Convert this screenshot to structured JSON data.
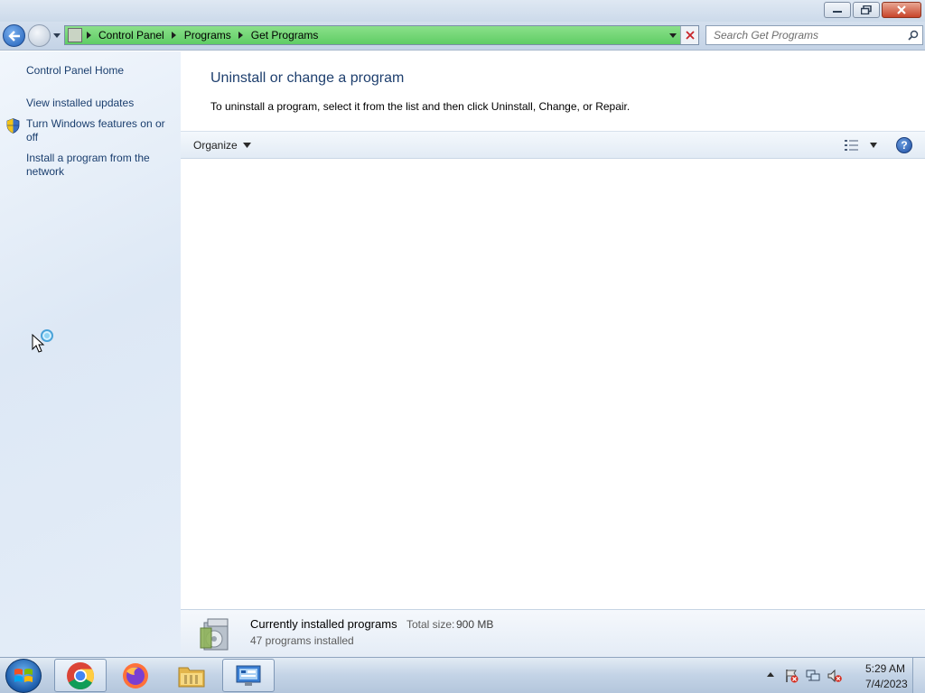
{
  "window": {
    "caption_buttons": [
      {
        "name": "minimize",
        "icon": "minimize-icon"
      },
      {
        "name": "maximize",
        "icon": "restore-icon"
      },
      {
        "name": "close",
        "icon": "close-icon"
      }
    ]
  },
  "navbar": {
    "breadcrumbs": [
      "Control Panel",
      "Programs",
      "Get Programs"
    ],
    "search_placeholder": "Search Get Programs",
    "address_color": "#6bd26f"
  },
  "sidebar": {
    "items": [
      {
        "label": "Control Panel Home"
      },
      {
        "label": "View installed updates"
      },
      {
        "label": "Turn Windows features on or off",
        "icon": "uac-shield-icon"
      },
      {
        "label": "Install a program from the network"
      }
    ]
  },
  "main": {
    "title": "Uninstall or change a program",
    "description": "To uninstall a program, select it from the list and then click Uninstall, Change, or Repair.",
    "toolbar": {
      "organize_label": "Organize",
      "help_label": "?"
    },
    "details": {
      "title": "Currently installed programs",
      "total_size_label": "Total size:",
      "total_size_value": "900 MB",
      "count_text": "47 programs installed"
    }
  },
  "taskbar": {
    "apps": [
      {
        "name": "chrome",
        "icon": "chrome-icon"
      },
      {
        "name": "firefox",
        "icon": "firefox-icon"
      },
      {
        "name": "file-explorer",
        "icon": "folder-icon"
      },
      {
        "name": "control-panel",
        "icon": "control-panel-icon",
        "active": true
      }
    ],
    "clock": {
      "time": "5:29 AM",
      "date": "7/4/2023"
    }
  }
}
